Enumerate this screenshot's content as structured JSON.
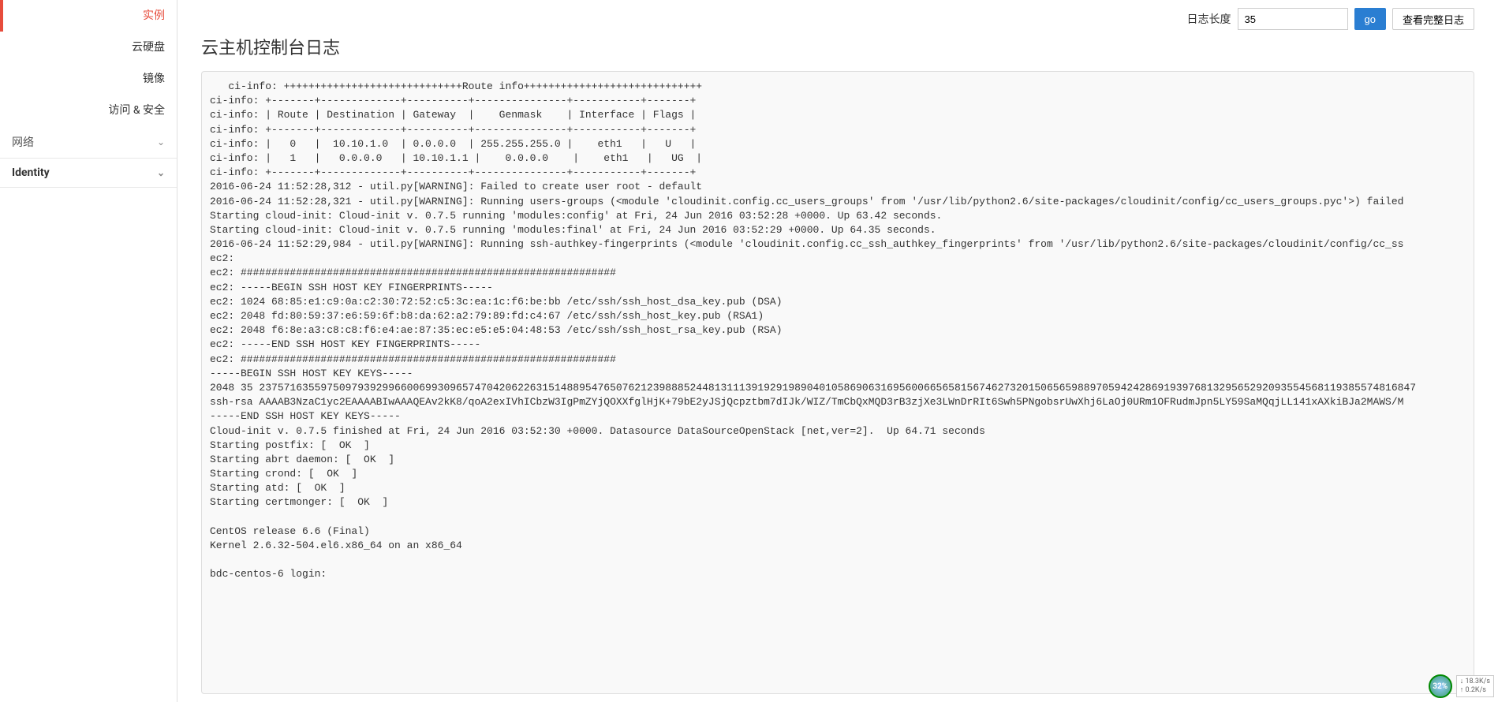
{
  "sidebar": {
    "items": [
      {
        "label": "实例",
        "active": true
      },
      {
        "label": "云硬盘",
        "active": false
      },
      {
        "label": "镜像",
        "active": false
      },
      {
        "label": "访问 & 安全",
        "active": false
      }
    ],
    "sections": [
      {
        "label": "网络",
        "bold": false
      },
      {
        "label": "Identity",
        "bold": true
      }
    ]
  },
  "toolbar": {
    "log_length_label": "日志长度",
    "log_length_value": "35",
    "go_button": "go",
    "view_full_log": "查看完整日志"
  },
  "page": {
    "title": "云主机控制台日志"
  },
  "log": {
    "content": "   ci-info: +++++++++++++++++++++++++++++Route info+++++++++++++++++++++++++++++\nci-info: +-------+-------------+----------+---------------+-----------+-------+\nci-info: | Route | Destination | Gateway  |    Genmask    | Interface | Flags |\nci-info: +-------+-------------+----------+---------------+-----------+-------+\nci-info: |   0   |  10.10.1.0  | 0.0.0.0  | 255.255.255.0 |    eth1   |   U   |\nci-info: |   1   |   0.0.0.0   | 10.10.1.1 |    0.0.0.0    |    eth1   |   UG  |\nci-info: +-------+-------------+----------+---------------+-----------+-------+\n2016-06-24 11:52:28,312 - util.py[WARNING]: Failed to create user root - default\n2016-06-24 11:52:28,321 - util.py[WARNING]: Running users-groups (<module 'cloudinit.config.cc_users_groups' from '/usr/lib/python2.6/site-packages/cloudinit/config/cc_users_groups.pyc'>) failed\nStarting cloud-init: Cloud-init v. 0.7.5 running 'modules:config' at Fri, 24 Jun 2016 03:52:28 +0000. Up 63.42 seconds.\nStarting cloud-init: Cloud-init v. 0.7.5 running 'modules:final' at Fri, 24 Jun 2016 03:52:29 +0000. Up 64.35 seconds.\n2016-06-24 11:52:29,984 - util.py[WARNING]: Running ssh-authkey-fingerprints (<module 'cloudinit.config.cc_ssh_authkey_fingerprints' from '/usr/lib/python2.6/site-packages/cloudinit/config/cc_ss\nec2: \nec2: #############################################################\nec2: -----BEGIN SSH HOST KEY FINGERPRINTS-----\nec2: 1024 68:85:e1:c9:0a:c2:30:72:52:c5:3c:ea:1c:f6:be:bb /etc/ssh/ssh_host_dsa_key.pub (DSA)\nec2: 2048 fd:80:59:37:e6:59:6f:b8:da:62:a2:79:89:fd:c4:67 /etc/ssh/ssh_host_key.pub (RSA1)\nec2: 2048 f6:8e:a3:c8:c8:f6:e4:ae:87:35:ec:e5:e5:04:48:53 /etc/ssh/ssh_host_rsa_key.pub (RSA)\nec2: -----END SSH HOST KEY FINGERPRINTS-----\nec2: #############################################################\n-----BEGIN SSH HOST KEY KEYS-----\n2048 35 23757163559750979392996600699309657470420622631514889547650762123988852448131113919291989040105869063169560066565815674627320150656598897059424286919397681329565292093554568119385574816847\nssh-rsa AAAAB3NzaC1yc2EAAAABIwAAAQEAv2kK8/qoA2exIVhICbzW3IgPmZYjQOXXfglHjK+79bE2yJSjQcpztbm7dIJk/WIZ/TmCbQxMQD3rB3zjXe3LWnDrRIt6Swh5PNgobsrUwXhj6LaOj0URm1OFRudmJpn5LY59SaMQqjLL141xAXkiBJa2MAWS/M\n-----END SSH HOST KEY KEYS-----\nCloud-init v. 0.7.5 finished at Fri, 24 Jun 2016 03:52:30 +0000. Datasource DataSourceOpenStack [net,ver=2].  Up 64.71 seconds\nStarting postfix: [  OK  ]\nStarting abrt daemon: [  OK  ]\nStarting crond: [  OK  ]\nStarting atd: [  OK  ]\nStarting certmonger: [  OK  ]\n\nCentOS release 6.6 (Final)\nKernel 2.6.32-504.el6.x86_64 on an x86_64\n\nbdc-centos-6 login: "
  },
  "footer": {
    "badge": "32%",
    "download": "18.3K/s",
    "upload": "0.2K/s"
  }
}
